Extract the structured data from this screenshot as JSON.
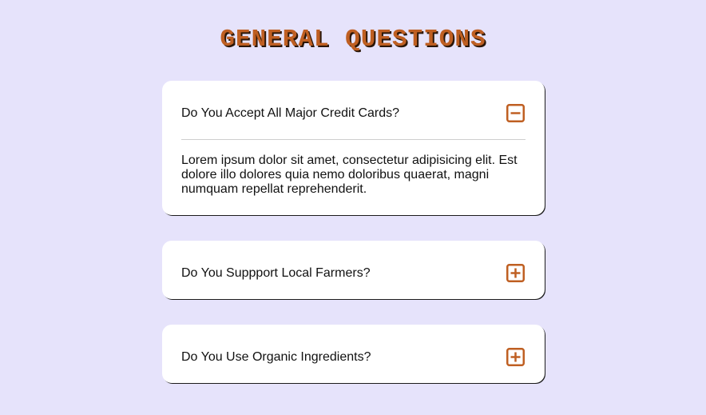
{
  "page": {
    "title": "GENERAL QUESTIONS"
  },
  "colors": {
    "background": "#e6e3fb",
    "accent": "#bf5f22",
    "card": "#ffffff"
  },
  "faqs": [
    {
      "question": "Do You Accept All Major Credit Cards?",
      "answer": "Lorem ipsum dolor sit amet, consectetur adipisicing elit. Est dolore illo dolores quia nemo doloribus quaerat, magni numquam repellat reprehenderit.",
      "expanded": true,
      "icon": "minus-square-icon"
    },
    {
      "question": "Do You Suppport Local Farmers?",
      "expanded": false,
      "icon": "plus-square-icon"
    },
    {
      "question": "Do You Use Organic Ingredients?",
      "expanded": false,
      "icon": "plus-square-icon"
    }
  ]
}
